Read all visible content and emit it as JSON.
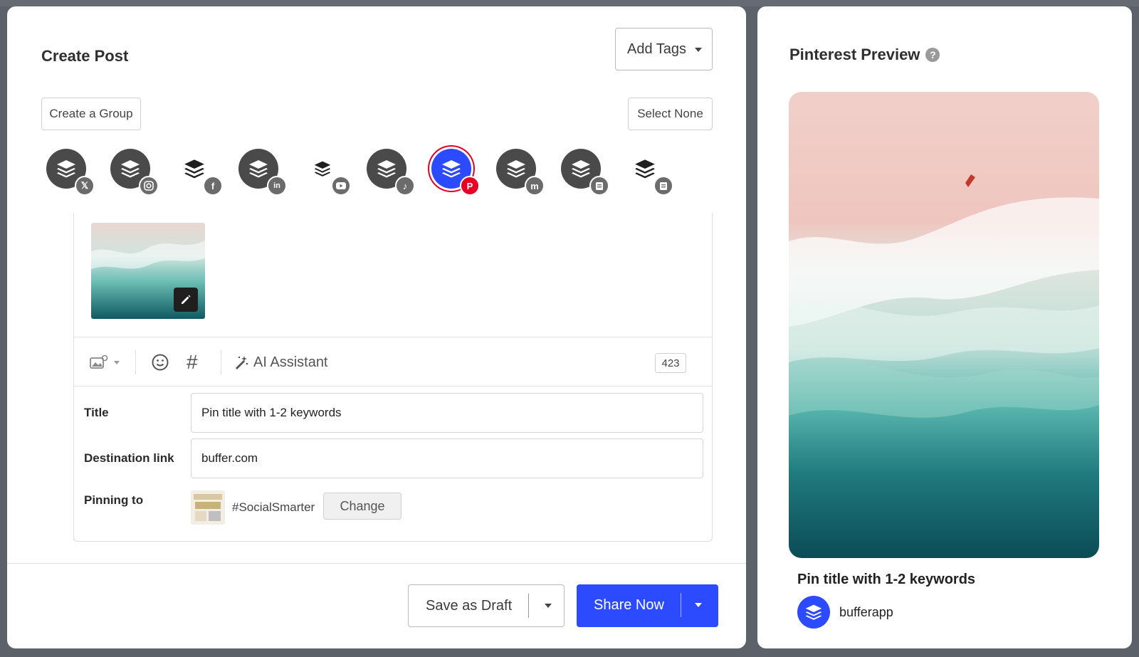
{
  "create_post": {
    "title": "Create Post",
    "add_tags_label": "Add Tags",
    "create_group_label": "Create a Group",
    "select_none_label": "Select None",
    "channels": [
      {
        "network": "x",
        "icon": "x-icon",
        "selected": false
      },
      {
        "network": "instagram",
        "icon": "instagram-icon",
        "selected": false
      },
      {
        "network": "facebook",
        "icon": "facebook-icon",
        "selected": false
      },
      {
        "network": "linkedin",
        "icon": "linkedin-icon",
        "selected": false
      },
      {
        "network": "youtube",
        "icon": "youtube-icon",
        "selected": false
      },
      {
        "network": "tiktok",
        "icon": "tiktok-icon",
        "selected": false
      },
      {
        "network": "pinterest",
        "icon": "pinterest-icon",
        "selected": true
      },
      {
        "network": "mastodon",
        "icon": "mastodon-icon",
        "selected": false
      },
      {
        "network": "google-business",
        "icon": "business-icon",
        "selected": false
      },
      {
        "network": "google-business-2",
        "icon": "business-icon",
        "selected": false
      }
    ],
    "toolbar": {
      "ai_assistant_label": "AI Assistant",
      "char_count": "423"
    },
    "fields": {
      "title_label": "Title",
      "title_value": "Pin title with 1-2 keywords",
      "destination_label": "Destination link",
      "destination_value": "buffer.com",
      "pinning_label": "Pinning to",
      "board_name": "#SocialSmarter",
      "change_label": "Change"
    },
    "footer": {
      "save_draft_label": "Save as Draft",
      "share_now_label": "Share Now"
    }
  },
  "preview": {
    "title": "Pinterest Preview",
    "help_icon": "?",
    "pin_title": "Pin title with 1-2 keywords",
    "username": "bufferapp"
  },
  "colors": {
    "accent": "#2c4bff",
    "pinterest_red": "#e60023",
    "avatar_dark": "#4a4a4a"
  }
}
